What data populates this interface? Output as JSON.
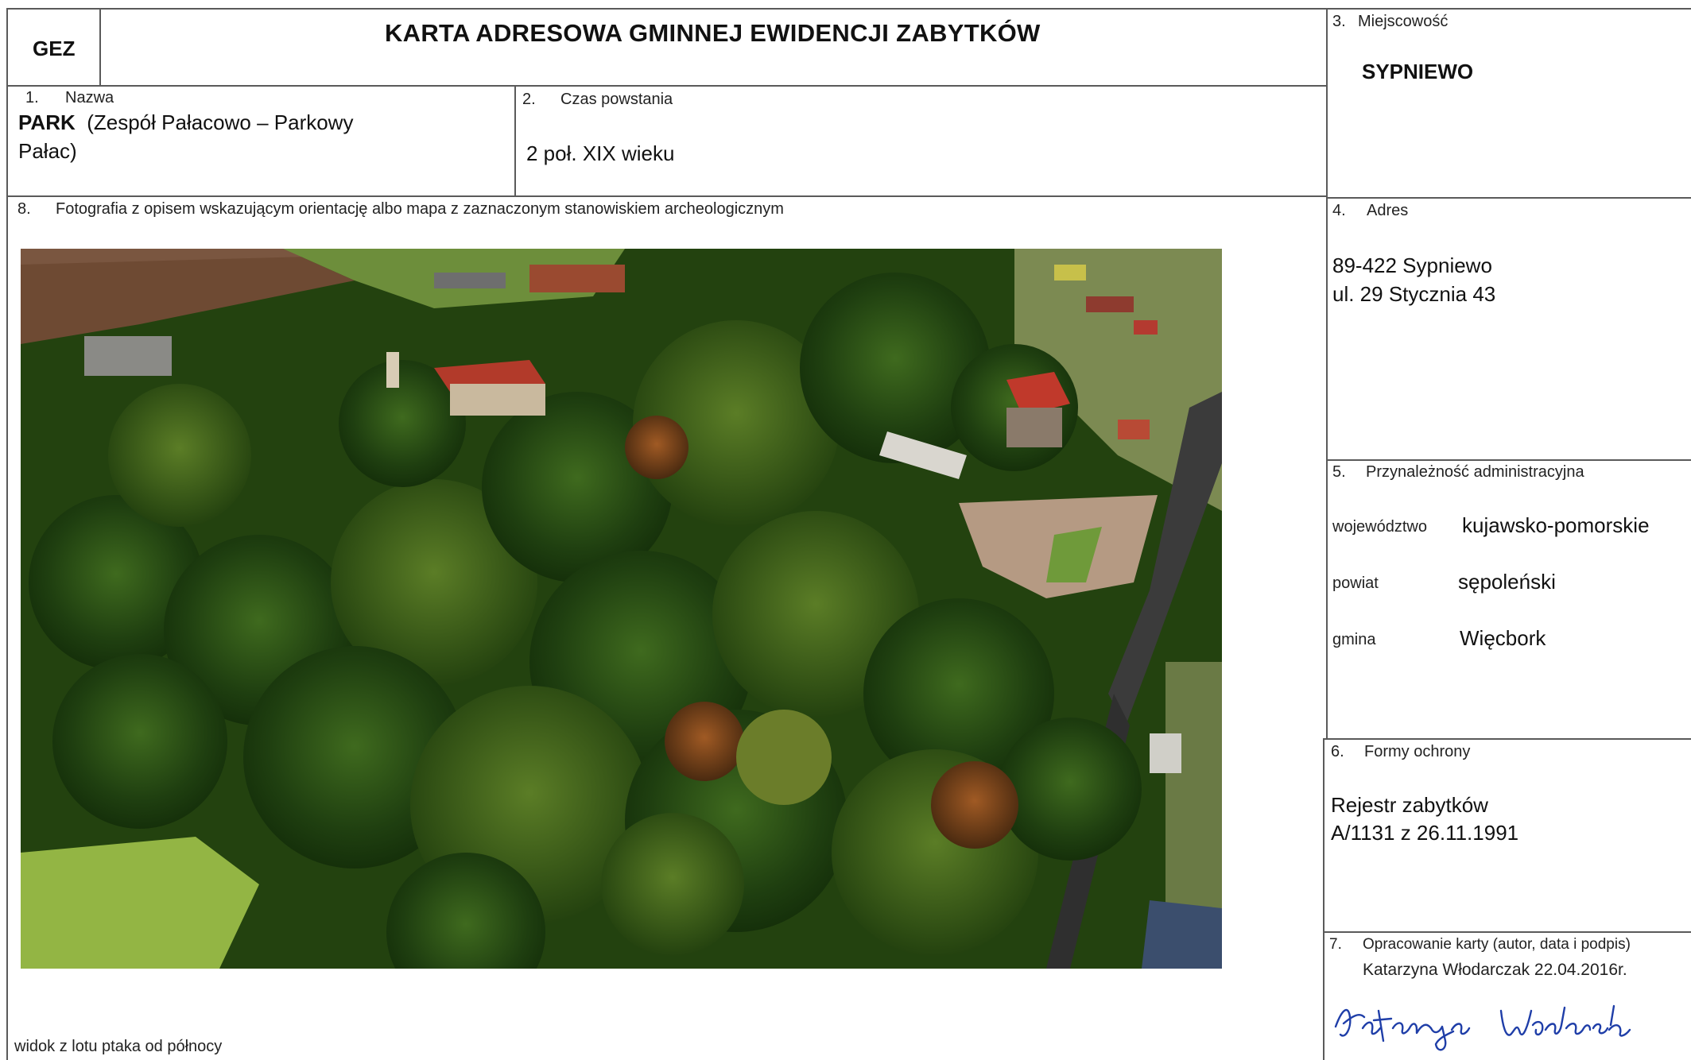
{
  "header": {
    "code": "GEZ",
    "title": "KARTA ADRESOWA GMINNEJ EWIDENCJI ZABYTKÓW"
  },
  "fields": {
    "name": {
      "num": "1.",
      "label": "Nazwa",
      "value_bold": "PARK",
      "value_rest_line1": "(Zespół Pałacowo – Parkowy",
      "value_rest_line2": "Pałac)"
    },
    "date": {
      "num": "2.",
      "label": "Czas powstania",
      "value": "2 poł. XIX wieku"
    },
    "locality": {
      "num": "3.",
      "label": "Miejscowość",
      "value": "SYPNIEWO"
    },
    "address": {
      "num": "4.",
      "label": "Adres",
      "line1": "89-422 Sypniewo",
      "line2": "ul. 29 Stycznia 43"
    },
    "admin": {
      "num": "5.",
      "label": "Przynależność administracyjna",
      "rows": [
        {
          "key": "województwo",
          "value": "kujawsko-pomorskie"
        },
        {
          "key": "powiat",
          "value": "sępoleński"
        },
        {
          "key": "gmina",
          "value": "Więcbork"
        }
      ]
    },
    "protection": {
      "num": "6.",
      "label": "Formy ochrony",
      "line1": "Rejestr zabytków",
      "line2": "A/1131 z 26.11.1991"
    },
    "author": {
      "num": "7.",
      "label": "Opracowanie karty (autor, data i podpis)",
      "value": "Katarzyna Włodarczak 22.04.2016r.",
      "signature": "Katarzyna Włodarczak"
    },
    "photo": {
      "num": "8.",
      "label": "Fotografia z opisem wskazującym orientację albo mapa z zaznaczonym stanowiskiem archeologicznym",
      "caption": "widok z lotu ptaka od północy"
    }
  },
  "colors": {
    "border": "#5a5a5a",
    "signature_ink": "#1f3ea8"
  }
}
